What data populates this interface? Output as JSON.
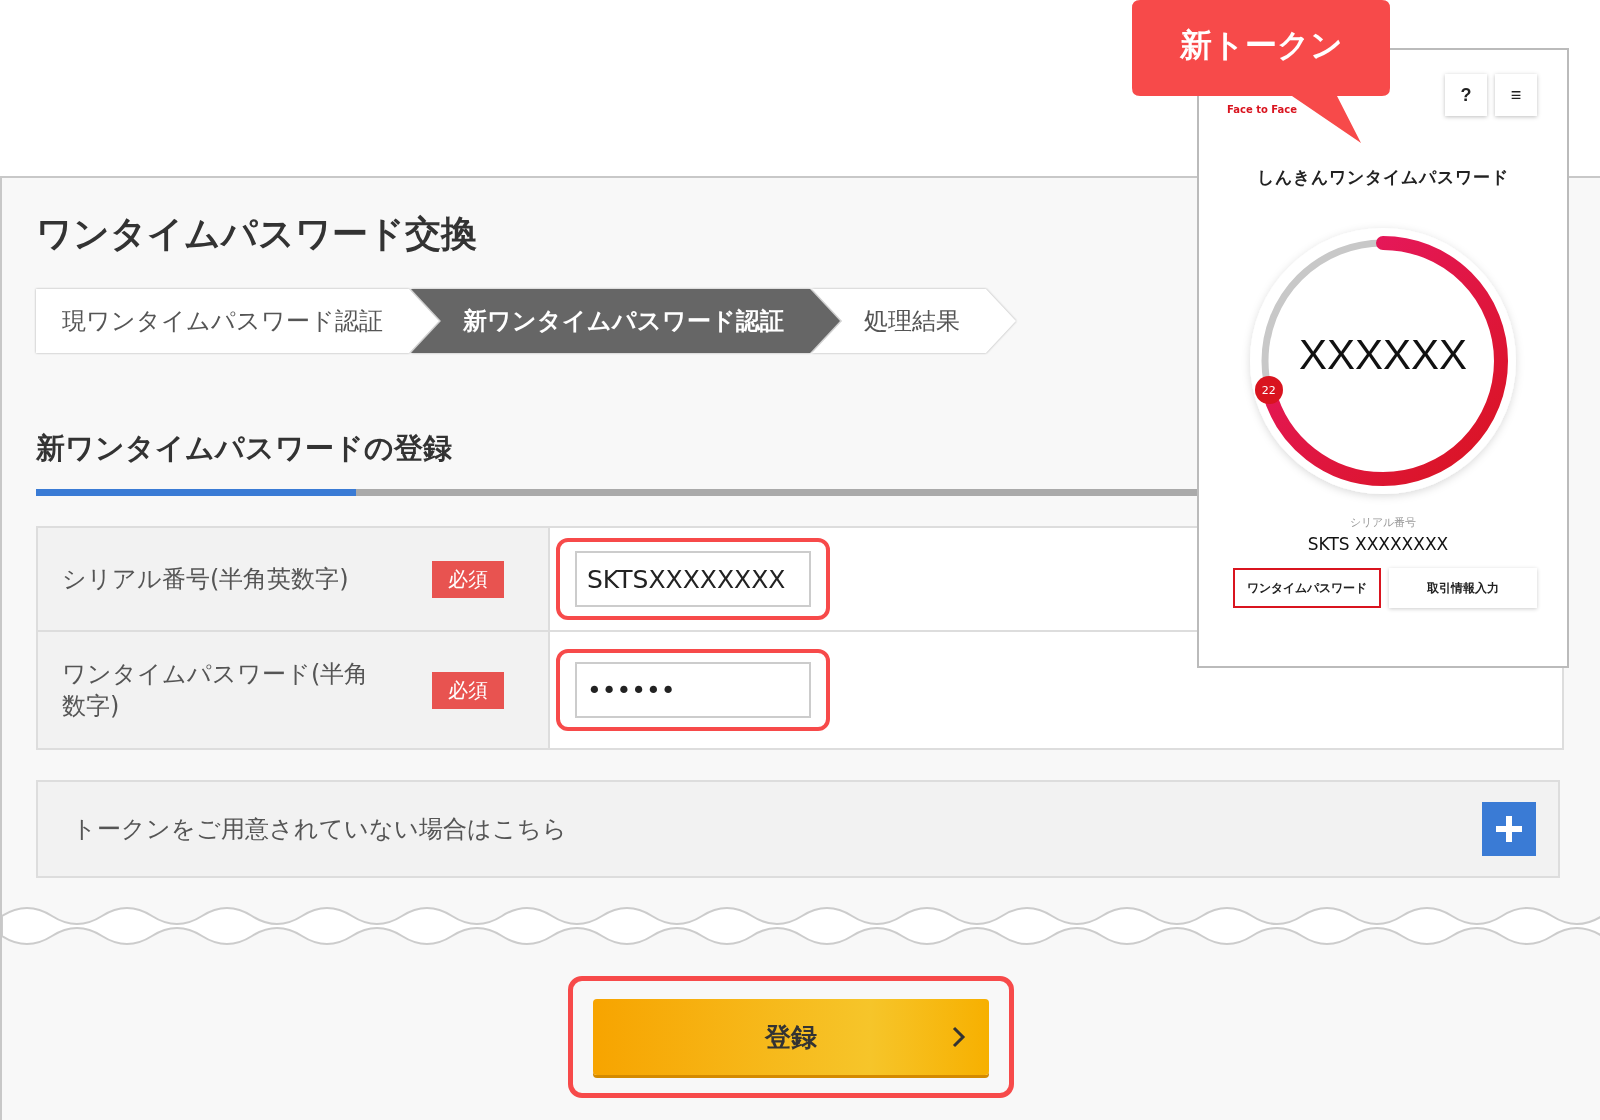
{
  "page": {
    "title": "ワンタイムパスワード交換",
    "steps": [
      {
        "label": "現ワンタイムパスワード認証",
        "selected": false
      },
      {
        "label": "新ワンタイムパスワード認証",
        "selected": true
      },
      {
        "label": "処理結果",
        "selected": false
      }
    ],
    "section_title": "新ワンタイムパスワードの登録",
    "section_progress": {
      "level": 0.21
    },
    "form_rows": [
      {
        "label": "シリアル番号(半角英数字)",
        "badge": "必須",
        "value": "SKTSXXXXXXXX",
        "highlighted": true
      },
      {
        "label": "ワンタイムパスワード(半角数字)",
        "badge": "必須",
        "value": "••••••",
        "highlighted": true
      }
    ],
    "expand_panel": {
      "label": "トークンをご用意されていない場合はこちら",
      "expanded": false
    },
    "submit_button": {
      "label": "登録",
      "highlighted": true
    }
  },
  "token_app": {
    "logo_text": "Face to Face",
    "help_button": "?",
    "menu_button": "≡",
    "title": "しんきんワンタイムパスワード",
    "code": "XXXXXX",
    "timer": {
      "level": 0.71,
      "seconds": "22"
    },
    "serial_label": "シリアル番号",
    "serial": "SKTS XXXXXXXX",
    "tabs": [
      {
        "label": "ワンタイムパスワード",
        "selected": true
      },
      {
        "label": "取引情報入力",
        "selected": false
      }
    ]
  },
  "callout": {
    "label": "新トークン"
  }
}
